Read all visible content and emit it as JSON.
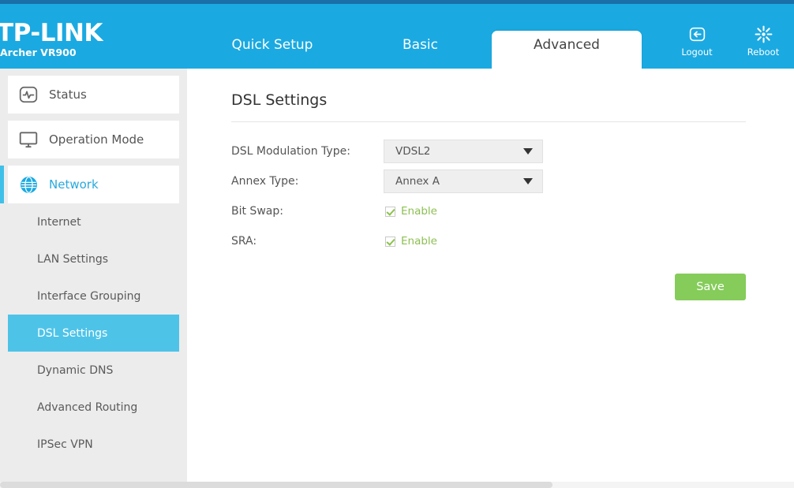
{
  "brand": {
    "name": "TP-LINK",
    "model": "Archer VR900"
  },
  "nav": {
    "tabs": [
      {
        "label": "Quick Setup",
        "active": false
      },
      {
        "label": "Basic",
        "active": false
      },
      {
        "label": "Advanced",
        "active": true
      }
    ],
    "actions": [
      {
        "label": "Logout",
        "icon": "logout-icon"
      },
      {
        "label": "Reboot",
        "icon": "reboot-icon"
      }
    ]
  },
  "sidebar": {
    "menu": [
      {
        "label": "Status",
        "icon": "status-pulse-icon",
        "active": false
      },
      {
        "label": "Operation Mode",
        "icon": "monitor-icon",
        "active": false
      },
      {
        "label": "Network",
        "icon": "globe-icon",
        "active": true
      }
    ],
    "submenu": [
      {
        "label": "Internet",
        "active": false
      },
      {
        "label": "LAN Settings",
        "active": false
      },
      {
        "label": "Interface Grouping",
        "active": false
      },
      {
        "label": "DSL Settings",
        "active": true
      },
      {
        "label": "Dynamic DNS",
        "active": false
      },
      {
        "label": "Advanced Routing",
        "active": false
      },
      {
        "label": "IPSec VPN",
        "active": false
      }
    ]
  },
  "main": {
    "title": "DSL Settings",
    "fields": {
      "modulation": {
        "label": "DSL Modulation Type:",
        "value": "VDSL2"
      },
      "annex": {
        "label": "Annex Type:",
        "value": "Annex A"
      },
      "bit_swap": {
        "label": "Bit Swap:",
        "checkbox_label": "Enable",
        "checked": true
      },
      "sra": {
        "label": "SRA:",
        "checkbox_label": "Enable",
        "checked": true
      }
    },
    "save_label": "Save"
  },
  "colors": {
    "header_blue": "#1ba9e1",
    "top_strip": "#1a6fa8",
    "accent_cyan": "#3fc0e8",
    "active_submenu": "#4ec3e8",
    "save_green": "#85cc5a",
    "enable_green": "#8dbf53",
    "sidebar_gray": "#ececec"
  }
}
